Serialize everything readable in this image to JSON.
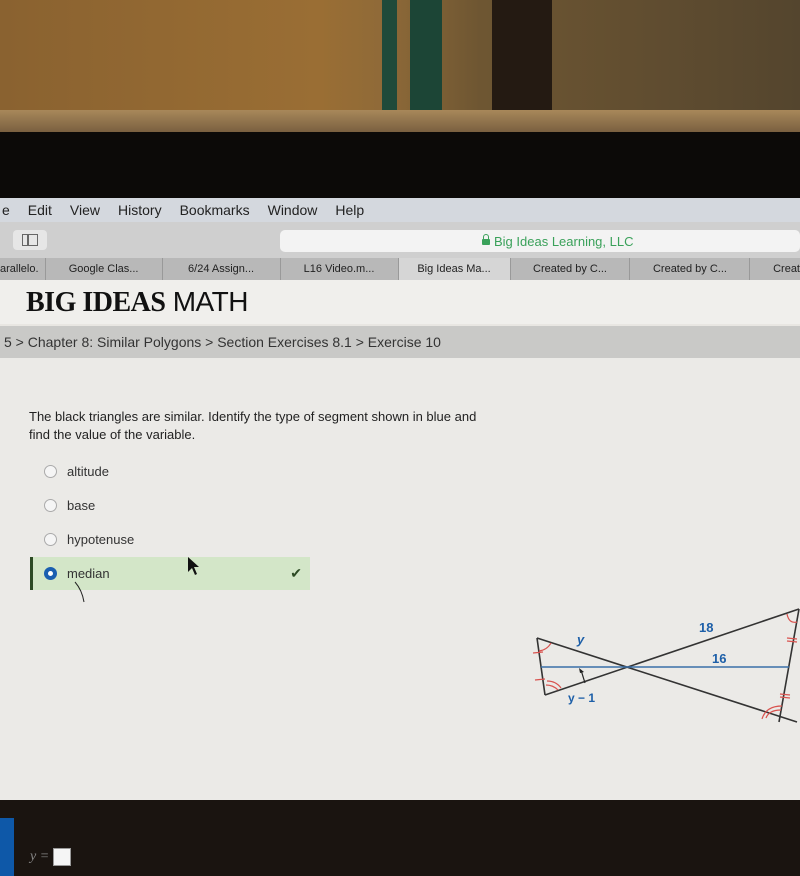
{
  "menubar": {
    "items": [
      "e",
      "Edit",
      "View",
      "History",
      "Bookmarks",
      "Window",
      "Help"
    ]
  },
  "toolbar": {
    "address_text": "Big Ideas Learning, LLC"
  },
  "tabs": [
    {
      "label": "arallelo."
    },
    {
      "label": "Google Clas..."
    },
    {
      "label": "6/24 Assign..."
    },
    {
      "label": "L16 Video.m..."
    },
    {
      "label": "Big Ideas Ma...",
      "active": true
    },
    {
      "label": "Created by C..."
    },
    {
      "label": "Created by C..."
    },
    {
      "label": "Creat"
    }
  ],
  "header": {
    "logo_bold": "BIG IDEAS",
    "logo_thin": " MATH"
  },
  "breadcrumb": "5 > Chapter 8: Similar Polygons > Section Exercises 8.1 > Exercise 10",
  "question": {
    "text": "The black triangles are similar. Identify the type of segment shown in blue and find the value of the variable.",
    "options": [
      {
        "label": "altitude",
        "selected": false
      },
      {
        "label": "base",
        "selected": false
      },
      {
        "label": "hypotenuse",
        "selected": false
      },
      {
        "label": "median",
        "selected": true,
        "correct": true
      }
    ],
    "answer_label": "y =",
    "answer_value": ""
  },
  "figure": {
    "labels": {
      "top_left": "y",
      "bottom_left": "y − 1",
      "top_right": "18",
      "blue_right": "16"
    },
    "colors": {
      "lines": "#333333",
      "segment": "#3a6fa8",
      "marks": "#d9534f",
      "label": "#1d5fa8"
    }
  },
  "colors": {
    "selected_bg": "#d3e6c8",
    "selected_bar": "#2c4a24",
    "radio_selected": "#1a5fb0",
    "secure_green": "#3aa15a"
  }
}
